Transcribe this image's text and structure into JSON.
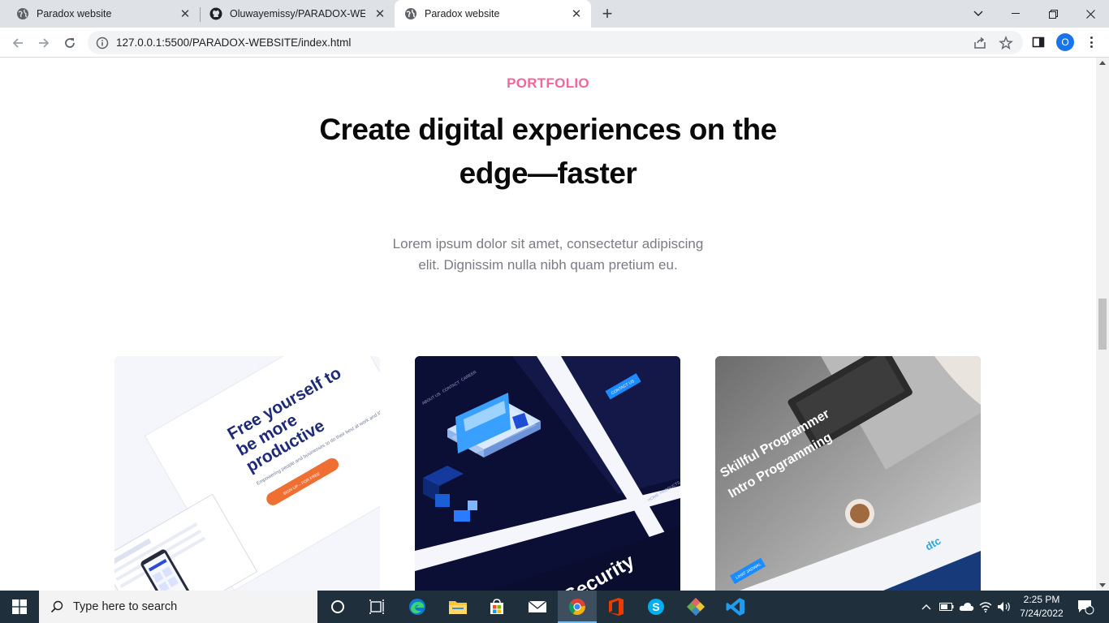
{
  "browser": {
    "tabs": [
      {
        "title": "Paradox website",
        "active": false
      },
      {
        "title": "Oluwayemissy/PARADOX-WEBSITE",
        "active": false
      },
      {
        "title": "Paradox website",
        "active": true
      }
    ],
    "url": "127.0.0.1:5500/PARADOX-WEBSITE/index.html",
    "profile_initial": "O"
  },
  "page": {
    "eyebrow": "PORTFOLIO",
    "headline": "Create digital experiences on the edge—faster",
    "description": "Lorem ipsum dolor sit amet, consectetur adipiscing elit. Dignissim nulla nibh quam pretium eu.",
    "cards": [
      {
        "name": "productivity-mockup",
        "lines": [
          "Free yourself to",
          "be more",
          "productive"
        ],
        "sub": "Empowering people and businesses to do their best at work and life with the help of technology",
        "cta": "SIGN UP – FOR FREE",
        "accent": "#ef6f32"
      },
      {
        "name": "security-mockup",
        "nav": [
          "ABOUT US",
          "CONTACT",
          "CAREER"
        ],
        "cta": "CONTACT US",
        "footer_nav": [
          "HOME",
          "PRODUCTS"
        ],
        "big_word": "Security",
        "accent": "#1a8cff"
      },
      {
        "name": "programming-mockup",
        "lines": [
          "Skillful Programmer",
          "Intro Programming"
        ],
        "brand": "dtc",
        "cta": "LIHAT JADWAL",
        "accent": "#1a8cff"
      }
    ]
  },
  "taskbar": {
    "search_placeholder": "Type here to search",
    "time": "2:25 PM",
    "date": "7/24/2022",
    "notification_count": "1",
    "apps": [
      "task-view",
      "edge",
      "file-explorer",
      "microsoft-store",
      "mail",
      "chrome",
      "office",
      "skype",
      "git",
      "vscode"
    ]
  },
  "colors": {
    "accent_pink": "#f2679a",
    "headline": "#0a0a0a",
    "muted_text": "#7b7b85",
    "taskbar": "#1f2f3b"
  }
}
